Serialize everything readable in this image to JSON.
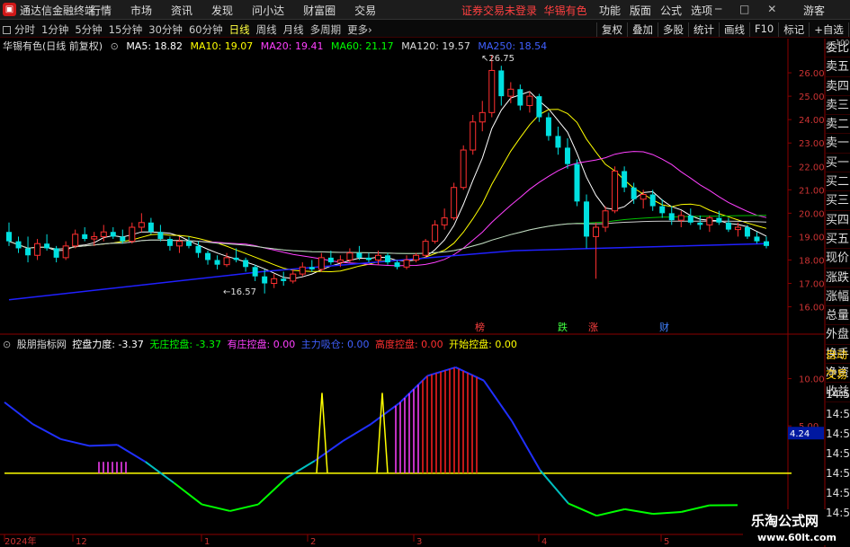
{
  "app": {
    "logo_glyph": "▣",
    "title": "通达信金融终端"
  },
  "main_menu": [
    "行情",
    "市场",
    "资讯",
    "发现",
    "问小达",
    "财富圈",
    "交易"
  ],
  "warning": "证券交易未登录",
  "stock_name_top": "华锡有色",
  "right_menu": [
    "功能",
    "版面",
    "公式",
    "选项"
  ],
  "window_controls": "─ □ ✕",
  "guest": "游客",
  "toolbar": {
    "periods": [
      "分时",
      "1分钟",
      "5分钟",
      "15分钟",
      "30分钟",
      "60分钟",
      "日线",
      "周线",
      "月线",
      "多周期",
      "更多›"
    ],
    "active_period": "日线",
    "right_tools": [
      "复权",
      "叠加",
      "多股",
      "统计",
      "画线",
      "F10",
      "标记",
      "+自选",
      "返回"
    ]
  },
  "chart_header": {
    "stock": "华锡有色(日线 前复权)",
    "ma": [
      {
        "label": "MA5: 18.82",
        "color": "#ffffff"
      },
      {
        "label": "MA10: 19.07",
        "color": "#ffff00"
      },
      {
        "label": "MA20: 19.41",
        "color": "#ff40ff"
      },
      {
        "label": "MA60: 21.17",
        "color": "#00ff00"
      },
      {
        "label": "MA120: 19.57",
        "color": "#dddddd"
      },
      {
        "label": "MA250: 18.54",
        "color": "#4060ff"
      }
    ]
  },
  "indicator_header": {
    "name": "股朋指标网",
    "items": [
      {
        "label": "控盘力度: -3.37",
        "color": "#ffffff"
      },
      {
        "label": "无庄控盘: -3.37",
        "color": "#00ff00"
      },
      {
        "label": "有庄控盘: 0.00",
        "color": "#ff40ff"
      },
      {
        "label": "主力吸仓: 0.00",
        "color": "#4060ff"
      },
      {
        "label": "高度控盘: 0.00",
        "color": "#ff3030"
      },
      {
        "label": "开始控盘: 0.00",
        "color": "#ffff00"
      }
    ]
  },
  "side_quote": [
    "委比",
    "卖五",
    "卖四",
    "卖三",
    "卖二",
    "卖一",
    "买一",
    "买二",
    "买三",
    "买四",
    "买五",
    "现价",
    "涨跌",
    "涨幅",
    "总量",
    "外盘",
    "换手",
    "净资",
    "收益"
  ],
  "side_bottom": [
    "自动",
    "交易",
    "14:5",
    "14:5",
    "14:5",
    "14:5",
    "14:5",
    "14:5",
    "14:5"
  ],
  "price_axis": [
    "26.00",
    "25.00",
    "24.00",
    "23.00",
    "22.00",
    "21.00",
    "20.00",
    "19.00",
    "18.00",
    "17.00",
    "16.00"
  ],
  "price_axis_top": "1000",
  "high_label": "26.75",
  "low_label": "16.57",
  "ind_axis": [
    "10.00",
    "5.00"
  ],
  "ind_cur_value": "4.24",
  "date_axis": [
    "2024年",
    "12",
    "1",
    "2",
    "3",
    "4",
    "5"
  ],
  "event_marks": [
    {
      "label": "榜",
      "color": "#ff4040"
    },
    {
      "label": "跌",
      "color": "#40ff40"
    },
    {
      "label": "涨",
      "color": "#ff4040"
    },
    {
      "label": "财",
      "color": "#4080ff"
    }
  ],
  "watermark": {
    "line1": "乐淘公式网",
    "line2": "www.60lt.com"
  },
  "colors": {
    "up": "#ff3030",
    "down": "#00e0e0",
    "axis": "#8b0000",
    "ma250": "#2020ff"
  },
  "chart_data": {
    "type": "candlestick",
    "price_range": [
      15.6,
      27.0
    ],
    "candles_ohlc": [
      [
        19.2,
        19.6,
        18.6,
        18.8
      ],
      [
        18.8,
        19.0,
        18.3,
        18.5
      ],
      [
        18.5,
        19.0,
        17.9,
        18.2
      ],
      [
        18.2,
        18.9,
        18.0,
        18.7
      ],
      [
        18.7,
        19.1,
        18.4,
        18.5
      ],
      [
        18.5,
        18.6,
        17.9,
        18.1
      ],
      [
        18.1,
        18.8,
        18.0,
        18.6
      ],
      [
        18.6,
        19.3,
        18.5,
        19.1
      ],
      [
        19.1,
        19.4,
        18.8,
        18.9
      ],
      [
        18.9,
        19.2,
        18.6,
        19.0
      ],
      [
        19.0,
        19.5,
        18.8,
        19.2
      ],
      [
        19.2,
        19.4,
        18.9,
        19.0
      ],
      [
        19.0,
        19.3,
        18.7,
        18.8
      ],
      [
        18.8,
        19.6,
        18.7,
        19.4
      ],
      [
        19.4,
        20.0,
        19.2,
        19.6
      ],
      [
        19.6,
        19.8,
        19.1,
        19.2
      ],
      [
        19.2,
        19.5,
        18.8,
        18.9
      ],
      [
        18.9,
        19.0,
        18.4,
        18.6
      ],
      [
        18.6,
        19.0,
        18.3,
        18.8
      ],
      [
        18.8,
        19.0,
        18.5,
        18.6
      ],
      [
        18.6,
        18.8,
        18.1,
        18.3
      ],
      [
        18.3,
        18.4,
        17.8,
        18.0
      ],
      [
        18.0,
        18.2,
        17.6,
        17.8
      ],
      [
        17.8,
        18.3,
        17.7,
        18.1
      ],
      [
        18.1,
        18.5,
        17.9,
        18.0
      ],
      [
        18.0,
        18.1,
        17.5,
        17.7
      ],
      [
        17.7,
        17.8,
        17.1,
        17.3
      ],
      [
        17.3,
        17.6,
        16.57,
        17.0
      ],
      [
        17.0,
        17.4,
        16.8,
        17.2
      ],
      [
        17.2,
        17.5,
        16.9,
        17.1
      ],
      [
        17.1,
        17.6,
        17.0,
        17.4
      ],
      [
        17.4,
        17.9,
        17.3,
        17.7
      ],
      [
        17.7,
        18.0,
        17.5,
        17.6
      ],
      [
        17.6,
        18.3,
        17.5,
        18.1
      ],
      [
        18.1,
        18.4,
        17.8,
        17.9
      ],
      [
        17.9,
        18.2,
        17.7,
        18.0
      ],
      [
        18.0,
        18.5,
        17.9,
        18.3
      ],
      [
        18.3,
        18.6,
        18.0,
        18.1
      ],
      [
        18.1,
        18.3,
        17.9,
        18.0
      ],
      [
        18.0,
        18.4,
        17.8,
        18.2
      ],
      [
        18.2,
        18.3,
        17.8,
        17.9
      ],
      [
        17.9,
        18.0,
        17.6,
        17.7
      ],
      [
        17.7,
        18.2,
        17.6,
        18.0
      ],
      [
        18.0,
        18.3,
        17.9,
        18.2
      ],
      [
        18.2,
        18.9,
        18.1,
        18.8
      ],
      [
        18.8,
        19.7,
        18.7,
        19.5
      ],
      [
        19.5,
        20.2,
        19.3,
        19.8
      ],
      [
        19.8,
        21.3,
        19.7,
        21.1
      ],
      [
        21.1,
        22.9,
        21.0,
        22.7
      ],
      [
        22.7,
        24.2,
        22.5,
        23.9
      ],
      [
        23.9,
        24.8,
        23.5,
        24.3
      ],
      [
        24.3,
        26.75,
        24.1,
        26.1
      ],
      [
        26.1,
        26.3,
        24.6,
        25.0
      ],
      [
        25.0,
        25.6,
        24.7,
        25.3
      ],
      [
        25.3,
        25.5,
        24.4,
        24.6
      ],
      [
        24.6,
        25.2,
        24.3,
        25.0
      ],
      [
        25.0,
        25.1,
        23.9,
        24.1
      ],
      [
        24.1,
        24.3,
        23.1,
        23.3
      ],
      [
        23.3,
        23.7,
        22.5,
        22.8
      ],
      [
        22.8,
        23.2,
        21.9,
        22.1
      ],
      [
        22.1,
        22.3,
        20.3,
        20.5
      ],
      [
        20.5,
        20.8,
        18.5,
        19.0
      ],
      [
        19.0,
        19.6,
        17.2,
        19.4
      ],
      [
        19.4,
        20.3,
        19.2,
        20.1
      ],
      [
        20.1,
        22.0,
        20.0,
        21.8
      ],
      [
        21.8,
        22.0,
        20.9,
        21.1
      ],
      [
        21.1,
        21.3,
        20.4,
        20.6
      ],
      [
        20.6,
        21.0,
        20.2,
        20.8
      ],
      [
        20.8,
        21.0,
        20.1,
        20.3
      ],
      [
        20.3,
        20.6,
        19.8,
        20.0
      ],
      [
        20.0,
        20.3,
        19.5,
        19.7
      ],
      [
        19.7,
        20.1,
        19.4,
        19.9
      ],
      [
        19.9,
        20.2,
        19.5,
        19.6
      ],
      [
        19.6,
        19.9,
        19.3,
        19.5
      ],
      [
        19.5,
        19.9,
        19.2,
        19.8
      ],
      [
        19.8,
        20.1,
        19.5,
        19.6
      ],
      [
        19.6,
        19.8,
        19.2,
        19.3
      ],
      [
        19.3,
        19.6,
        19.0,
        19.4
      ],
      [
        19.4,
        19.5,
        18.9,
        19.0
      ],
      [
        19.0,
        19.2,
        18.7,
        18.8
      ],
      [
        18.8,
        19.0,
        18.5,
        18.6
      ]
    ],
    "ma250": [
      16.3,
      17.5,
      18.4,
      18.7
    ],
    "indicator_line": [
      7.5,
      5.2,
      3.6,
      2.9,
      3.0,
      1.2,
      -1.0,
      -3.3,
      -4.0,
      -3.3,
      -0.5,
      1.3,
      3.4,
      5.2,
      7.4,
      10.3,
      11.2,
      9.8,
      5.5,
      0.3,
      -3.2,
      -4.5,
      -3.8,
      -4.3,
      -4.1,
      -3.4,
      -3.37
    ]
  }
}
